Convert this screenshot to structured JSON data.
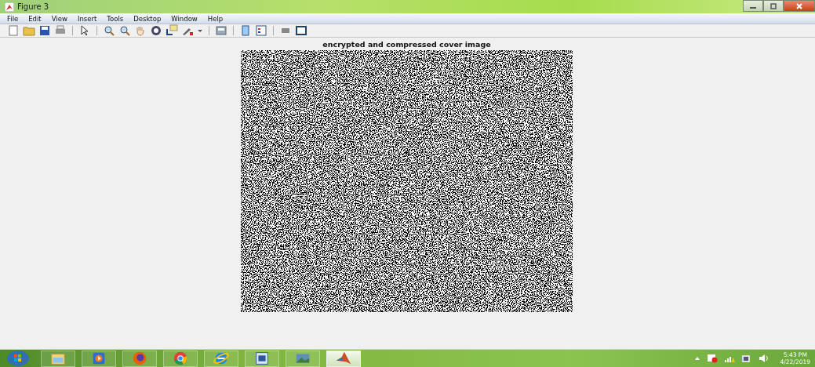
{
  "window": {
    "title": "Figure 3"
  },
  "menu": [
    "File",
    "Edit",
    "View",
    "Insert",
    "Tools",
    "Desktop",
    "Window",
    "Help"
  ],
  "figure": {
    "title": "encrypted and compressed cover image"
  },
  "taskbar": {
    "apps": [
      {
        "kind": "explorer",
        "selected": false
      },
      {
        "kind": "media",
        "selected": false
      },
      {
        "kind": "firefox",
        "selected": false
      },
      {
        "kind": "chrome",
        "selected": false
      },
      {
        "kind": "ie",
        "selected": false
      },
      {
        "kind": "word",
        "selected": false
      },
      {
        "kind": "viewer",
        "selected": false
      },
      {
        "kind": "matlab",
        "selected": true
      }
    ],
    "time": "5:43 PM",
    "date": "4/22/2019"
  }
}
